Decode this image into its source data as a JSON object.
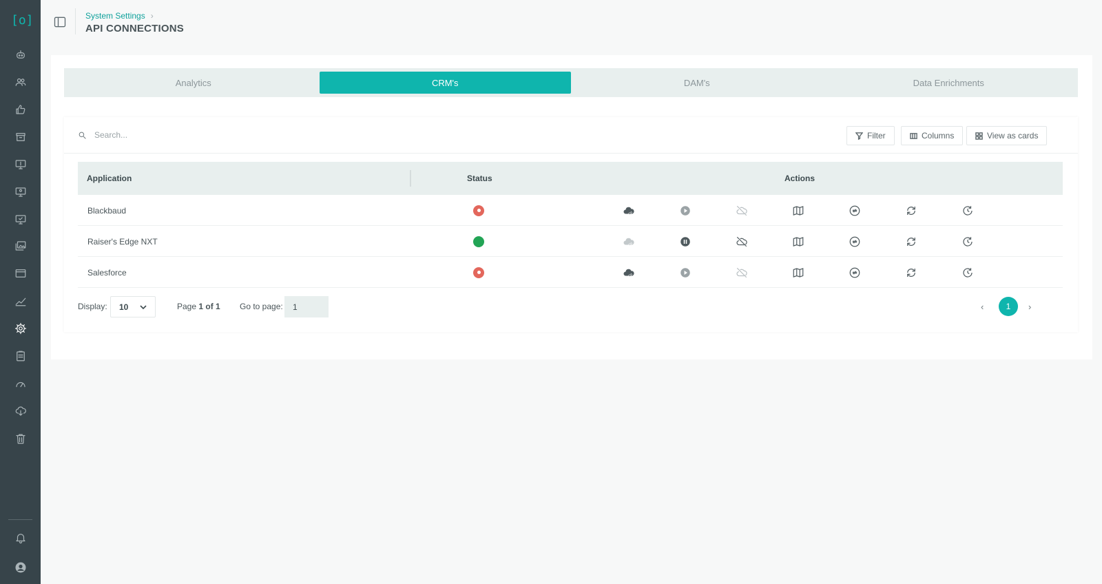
{
  "app": {
    "logo_text": "[o]"
  },
  "sidebar": {
    "items": [
      {
        "icon": "robot-icon"
      },
      {
        "icon": "users-icon"
      },
      {
        "icon": "thumbs-up-icon"
      },
      {
        "icon": "archive-icon"
      },
      {
        "icon": "monitor-dollar-icon"
      },
      {
        "icon": "monitor-user-icon"
      },
      {
        "icon": "monitor-check-icon"
      },
      {
        "icon": "images-icon"
      },
      {
        "icon": "browser-window-icon"
      },
      {
        "icon": "trend-line-icon"
      },
      {
        "icon": "gear-icon",
        "active": true
      },
      {
        "icon": "clipboard-icon"
      },
      {
        "icon": "speedometer-icon"
      },
      {
        "icon": "cloud-download-icon"
      },
      {
        "icon": "trash-icon"
      }
    ],
    "bottom": [
      {
        "icon": "bell-icon"
      },
      {
        "icon": "account-icon"
      }
    ]
  },
  "header": {
    "breadcrumb": "System Settings",
    "title": "API CONNECTIONS"
  },
  "tabs": [
    {
      "label": "Analytics",
      "active": false
    },
    {
      "label": "CRM's",
      "active": true
    },
    {
      "label": "DAM's",
      "active": false
    },
    {
      "label": "Data Enrichments",
      "active": false
    }
  ],
  "toolbar": {
    "search_placeholder": "Search...",
    "filter_label": "Filter",
    "columns_label": "Columns",
    "view_cards_label": "View as cards"
  },
  "table": {
    "columns": [
      "Application",
      "Status",
      "Actions"
    ],
    "rows": [
      {
        "application": "Blackbaud",
        "status": "disconnected",
        "actions": [
          "cloud-check-icon",
          "play-icon",
          "cloud-off-icon",
          "map-icon",
          "sync-circle-icon",
          "refresh-icon",
          "history-icon"
        ]
      },
      {
        "application": "Raiser's Edge NXT",
        "status": "connected",
        "actions": [
          "cloud-check-icon",
          "pause-icon",
          "cloud-off-icon",
          "map-icon",
          "sync-circle-icon",
          "refresh-icon",
          "history-icon"
        ]
      },
      {
        "application": "Salesforce",
        "status": "disconnected",
        "actions": [
          "cloud-check-icon",
          "play-icon",
          "cloud-off-icon",
          "map-icon",
          "sync-circle-icon",
          "refresh-icon",
          "history-icon"
        ]
      }
    ]
  },
  "pagination": {
    "display_label": "Display:",
    "display_value": "10",
    "page_prefix": "Page",
    "page_info": "1 of 1",
    "goto_label": "Go to page:",
    "goto_value": "1",
    "current_page": "1",
    "prev_symbol": "‹",
    "next_symbol": "›"
  },
  "colors": {
    "accent": "#0fb5ad",
    "sidebar_bg": "#37444a",
    "status_connected": "#22a455",
    "status_disconnected": "#e3675c"
  }
}
